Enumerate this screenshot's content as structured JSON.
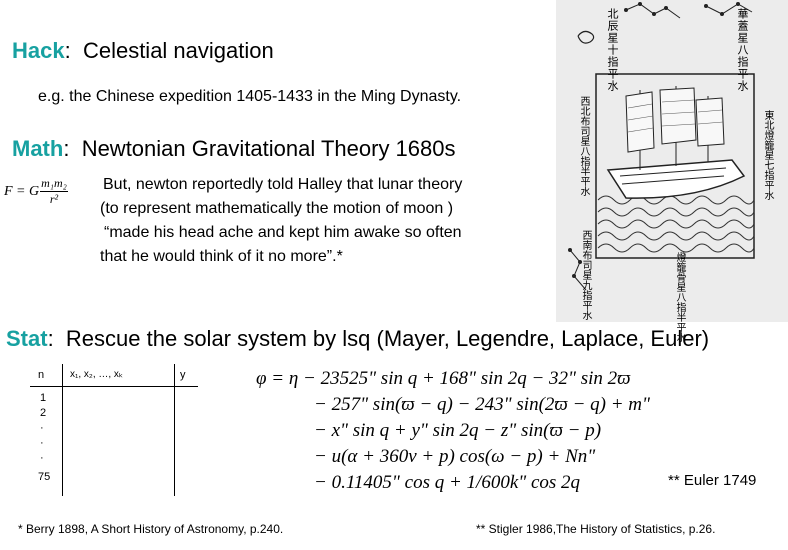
{
  "hack": {
    "label": "Hack",
    "colon": ":",
    "title": "Celestial navigation",
    "example": "e.g. the Chinese expedition 1405-1433 in the Ming Dynasty."
  },
  "math": {
    "label": "Math",
    "colon": ":",
    "title": "Newtonian Gravitational Theory  1680s",
    "formula_lhs": "F = G",
    "formula_num": "m₁m₂",
    "formula_den": "r²",
    "quote_line1": "But, newton reportedly told Halley that lunar theory",
    "quote_line2": "(to represent mathematically the motion of moon )",
    "quote_line3": "“made his head ache and kept him awake so often",
    "quote_line4": "that he would think of it no more”.*"
  },
  "stat": {
    "label": "Stat",
    "colon": ":",
    "title": "Rescue the solar system by lsq  (Mayer, Legendre, Laplace, Euler)"
  },
  "table": {
    "headers": [
      "n",
      "x₁,  x₂,  …,  xₖ",
      "y"
    ],
    "rows": [
      "1",
      "2",
      "·",
      "·",
      "·",
      "75"
    ]
  },
  "equation": {
    "line1": "φ = η − 23525\" sin q + 168\" sin 2q − 32\" sin 2ϖ",
    "line2": "− 257\" sin(ϖ − q) − 243\" sin(2ϖ − q) + m\"",
    "line3": "− x\" sin q + y\" sin 2q − z\" sin(ϖ − p)",
    "line4": "− u(α + 360v + p) cos(ω − p) + Nn\"",
    "line5": "− 0.11405\" cos q + 1/600k\" cos 2q"
  },
  "euler_note": "** Euler 1749",
  "footnotes": {
    "left": "* Berry 1898, A Short History of Astronomy,  p.240.",
    "right": "** Stigler 1986,The History of Statistics, p.26."
  },
  "illustration": {
    "description_icon": "chinese-navigation-chart-illustration",
    "chars_top": [
      "北辰星十指平水",
      "華蓋星八指平水",
      "西北布司星八指半平水",
      "西南布司星九指平水",
      "東北燈籠星七指平水",
      "燈籠骨星八指半平水"
    ]
  }
}
